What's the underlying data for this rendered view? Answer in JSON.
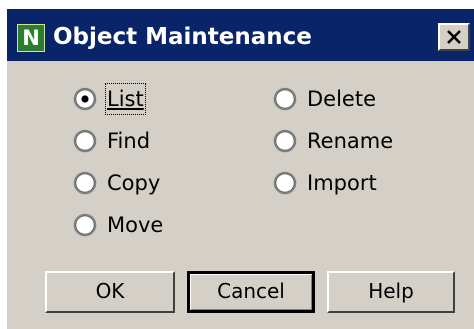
{
  "window": {
    "title": "Object Maintenance",
    "icon": "N",
    "close_label": "close"
  },
  "options": {
    "list": {
      "label": "List",
      "checked": true
    },
    "find": {
      "label": "Find",
      "checked": false
    },
    "copy": {
      "label": "Copy",
      "checked": false
    },
    "move": {
      "label": "Move",
      "checked": false
    },
    "delete": {
      "label": "Delete",
      "checked": false
    },
    "rename": {
      "label": "Rename",
      "checked": false
    },
    "import": {
      "label": "Import",
      "checked": false
    }
  },
  "buttons": {
    "ok": "OK",
    "cancel": "Cancel",
    "help": "Help"
  },
  "colors": {
    "titlebar": "#0a246a",
    "face": "#d4d0c8"
  }
}
